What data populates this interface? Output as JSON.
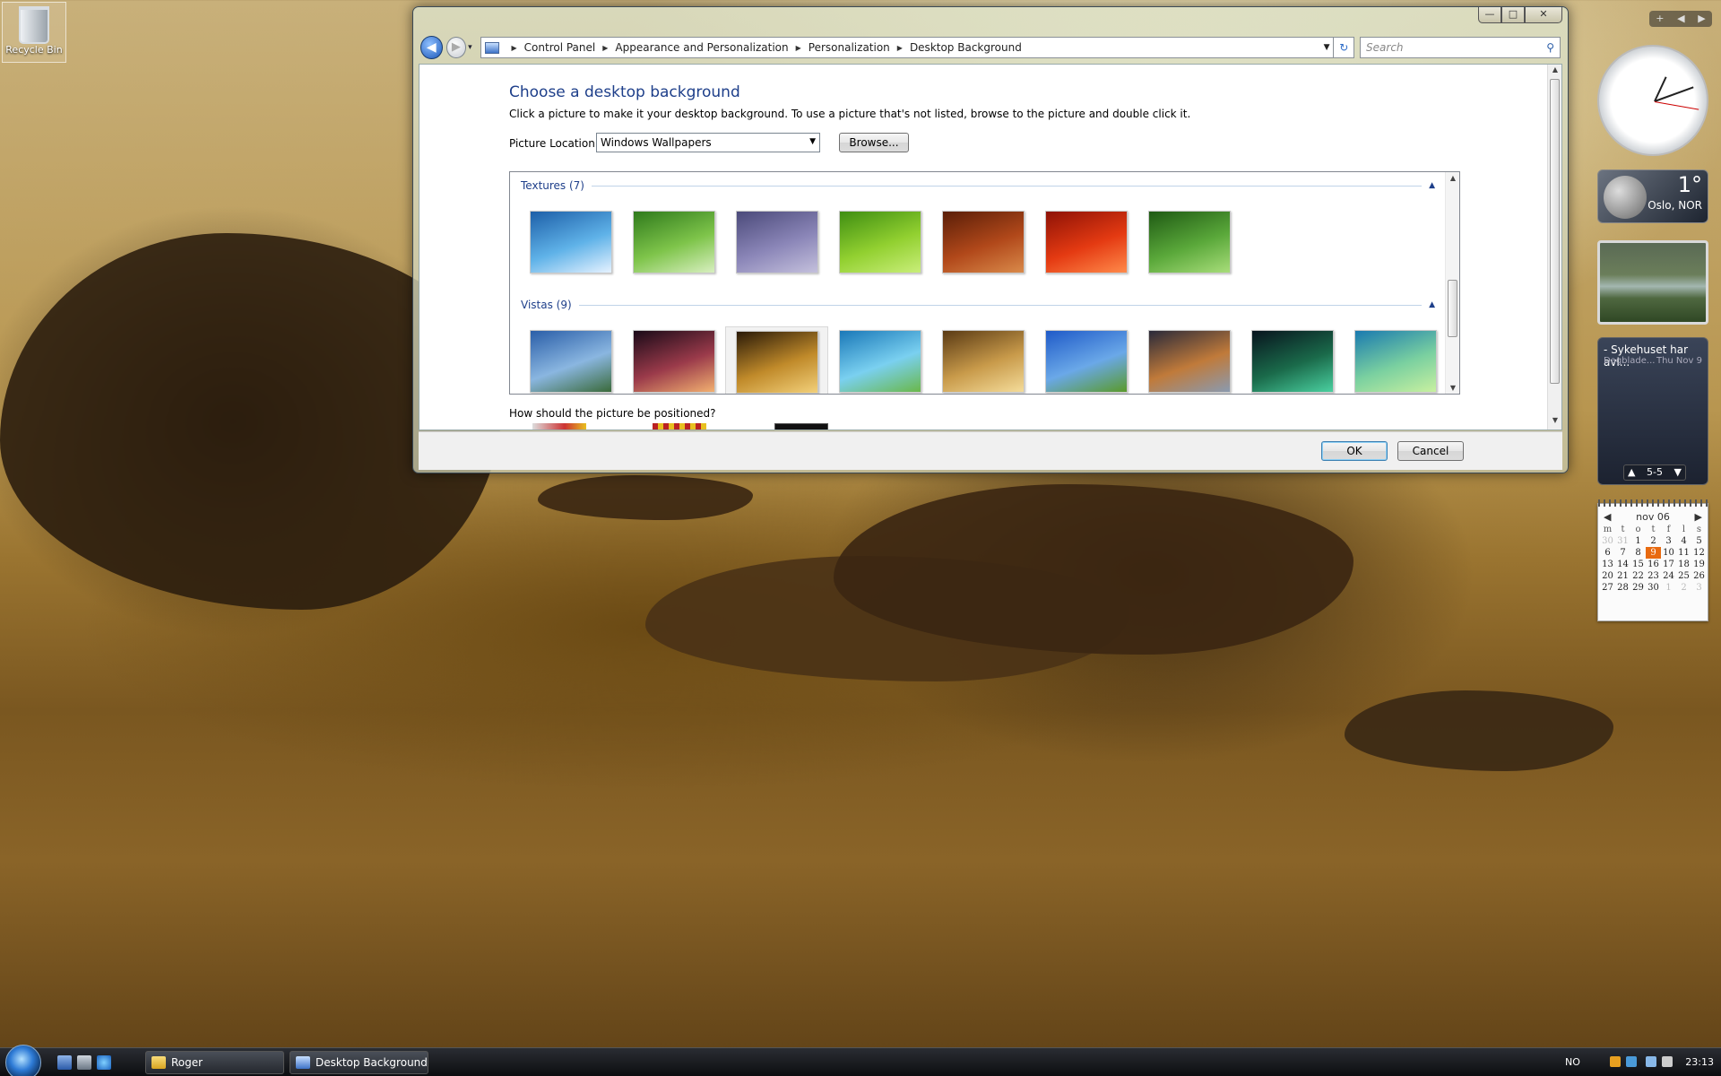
{
  "desktop": {
    "icons": [
      {
        "label": "Recycle Bin"
      }
    ]
  },
  "window": {
    "caption_buttons": {
      "minimize": "—",
      "maximize": "□",
      "close": "✕"
    },
    "nav": {
      "back": "◀",
      "forward": "▶",
      "dropdown": "▾"
    },
    "breadcrumbs": [
      "Control Panel",
      "Appearance and Personalization",
      "Personalization",
      "Desktop Background"
    ],
    "search_placeholder": "Search",
    "heading": "Choose a desktop background",
    "description": "Click a picture to make it your desktop background. To use a picture that's not listed, browse to the picture and double click it.",
    "picture_location_label": "Picture Location",
    "picture_location_value": "Windows Wallpapers",
    "browse_label": "Browse...",
    "groups": [
      {
        "title": "Textures (7)",
        "items": [
          {
            "icon": "fish-wallpaper",
            "colors": [
              "#1d5fa8",
              "#5fb2e8",
              "#e6f2ff"
            ]
          },
          {
            "icon": "grass-wallpaper",
            "colors": [
              "#2f7a1c",
              "#7ec44a",
              "#d8efc0"
            ]
          },
          {
            "icon": "pebbles-wallpaper",
            "colors": [
              "#4b4a7a",
              "#8b86b8",
              "#c4c0dc"
            ]
          },
          {
            "icon": "leaf-wallpaper",
            "colors": [
              "#3f8e12",
              "#92d030",
              "#c9ee7a"
            ]
          },
          {
            "icon": "wood-wallpaper",
            "colors": [
              "#5a1e08",
              "#b1481a",
              "#d98a4a"
            ]
          },
          {
            "icon": "flower-wallpaper",
            "colors": [
              "#8e1206",
              "#e43a12",
              "#ff8a4a"
            ]
          },
          {
            "icon": "bamboo-wallpaper",
            "colors": [
              "#1f5a14",
              "#5aa83a",
              "#a8dd7a"
            ]
          }
        ]
      },
      {
        "title": "Vistas (9)",
        "items": [
          {
            "icon": "mountain-lake-wallpaper",
            "colors": [
              "#2a5ea8",
              "#8ab6e0",
              "#3a6a3a"
            ]
          },
          {
            "icon": "sunset-silhouette-wallpaper",
            "colors": [
              "#1a0a18",
              "#9a3a4a",
              "#f2b070"
            ]
          },
          {
            "icon": "beach-rocks-wallpaper",
            "colors": [
              "#2a1a08",
              "#c08a2a",
              "#f2d07a"
            ]
          },
          {
            "icon": "palm-leaf-wallpaper",
            "colors": [
              "#1a78b8",
              "#7ad0f0",
              "#6ab84a"
            ]
          },
          {
            "icon": "wheat-field-wallpaper",
            "colors": [
              "#5a3a14",
              "#c89a4a",
              "#f4dc9a"
            ]
          },
          {
            "icon": "green-hills-wallpaper",
            "colors": [
              "#1f5ac8",
              "#6aa8e8",
              "#5a9a2a"
            ]
          },
          {
            "icon": "canyon-reflection-wallpaper",
            "colors": [
              "#2a2a3a",
              "#c07a3a",
              "#8a9ab0"
            ]
          },
          {
            "icon": "aurora-wallpaper",
            "colors": [
              "#08141e",
              "#1a6a4a",
              "#4ad0a0"
            ]
          },
          {
            "icon": "vista-aurora-wallpaper",
            "colors": [
              "#1a7ab0",
              "#7ad0a0",
              "#c8f0a0"
            ]
          }
        ]
      }
    ],
    "selected_group": 1,
    "selected_item": 2,
    "position_question": "How should the picture be positioned?",
    "ok_label": "OK",
    "cancel_label": "Cancel"
  },
  "gadgets": {
    "sidebar_controls": [
      "+",
      "◀",
      "▶"
    ],
    "weather": {
      "temp": "1°",
      "city": "Oslo, NOR"
    },
    "feed": {
      "headline": "- Sykehuset har avl...",
      "source": "Dagblade...",
      "date": "Thu Nov 9",
      "pager": "5-5",
      "prev": "▲",
      "next": "▼"
    },
    "calendar": {
      "month": "nov 06",
      "prev": "◀",
      "next": "▶",
      "weekdays": [
        "m",
        "t",
        "o",
        "t",
        "f",
        "l",
        "s"
      ],
      "weeks": [
        [
          "30",
          "31",
          "1",
          "2",
          "3",
          "4",
          "5"
        ],
        [
          "6",
          "7",
          "8",
          "9",
          "10",
          "11",
          "12"
        ],
        [
          "13",
          "14",
          "15",
          "16",
          "17",
          "18",
          "19"
        ],
        [
          "20",
          "21",
          "22",
          "23",
          "24",
          "25",
          "26"
        ],
        [
          "27",
          "28",
          "29",
          "30",
          "1",
          "2",
          "3"
        ]
      ],
      "today": "9"
    }
  },
  "taskbar": {
    "buttons": [
      {
        "label": "Roger",
        "icon": "folder-icon"
      },
      {
        "label": "Desktop Background",
        "icon": "control-panel-icon"
      }
    ],
    "tray": {
      "language": "NO",
      "time": "23:13"
    }
  }
}
